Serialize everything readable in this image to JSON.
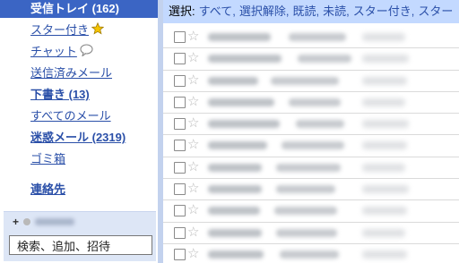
{
  "sidebar": {
    "items": [
      {
        "label": "受信トレイ (162)",
        "selected": true,
        "bold": true
      },
      {
        "label": "スター付き",
        "icon": "star-icon"
      },
      {
        "label": "チャット",
        "icon": "chat-bubble-icon"
      },
      {
        "label": "送信済みメール"
      },
      {
        "label": "下書き (13)",
        "bold": true
      },
      {
        "label": "すべてのメール"
      },
      {
        "label": "迷惑メール (2319)",
        "bold": true
      },
      {
        "label": "ゴミ箱"
      },
      {
        "label": "連絡先",
        "bold": true
      }
    ],
    "contacts_box": {
      "plus": "+",
      "search_value": "検索、追加、招待"
    }
  },
  "toolbar": {
    "select_label": "選択:",
    "options": [
      "すべて",
      "選択解除",
      "既読",
      "未読",
      "スター付き",
      "スター"
    ]
  },
  "rows": [
    {
      "checked": false,
      "starred": false
    },
    {
      "checked": false,
      "starred": false
    },
    {
      "checked": false,
      "starred": false
    },
    {
      "checked": false,
      "starred": false
    },
    {
      "checked": false,
      "starred": false
    },
    {
      "checked": false,
      "starred": false
    },
    {
      "checked": false,
      "starred": false
    },
    {
      "checked": false,
      "starred": false
    },
    {
      "checked": false,
      "starred": false
    },
    {
      "checked": false,
      "starred": false
    },
    {
      "checked": false,
      "starred": false
    }
  ],
  "colors": {
    "selected_bg": "#3b65c4",
    "link": "#2a4fa8",
    "toolbar_bg": "#c3d9ff",
    "contacts_bg": "#dde6f6",
    "star_yellow": "#f5c400"
  }
}
